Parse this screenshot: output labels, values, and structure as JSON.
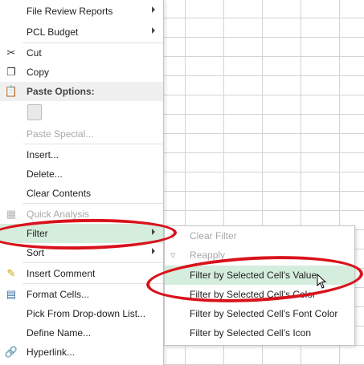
{
  "menu": {
    "file_review": "File Review Reports",
    "pcl_budget": "PCL Budget",
    "cut": "Cut",
    "copy": "Copy",
    "paste_options": "Paste Options:",
    "paste_special": "Paste Special...",
    "insert": "Insert...",
    "delete": "Delete...",
    "clear_contents": "Clear Contents",
    "quick_analysis": "Quick Analysis",
    "filter": "Filter",
    "sort": "Sort",
    "insert_comment": "Insert Comment",
    "format_cells": "Format Cells...",
    "pick_dropdown": "Pick From Drop-down List...",
    "define_name": "Define Name...",
    "hyperlink": "Hyperlink..."
  },
  "submenu": {
    "clear_filter": "Clear Filter",
    "reapply": "Reapply",
    "by_value": "Filter by Selected Cell's Value",
    "by_color": "Filter by Selected Cell's Color",
    "by_font_color": "Filter by Selected Cell's Font Color",
    "by_icon": "Filter by Selected Cell's Icon"
  },
  "colors": {
    "highlight": "#d5eddd",
    "annotation": "#d9121b"
  }
}
